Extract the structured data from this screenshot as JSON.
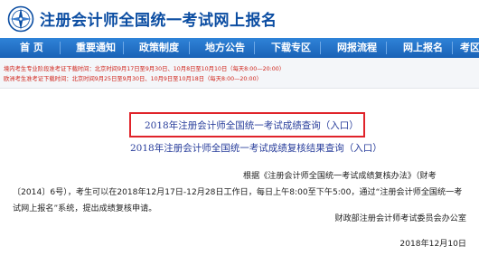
{
  "header": {
    "site_title": "注册会计师全国统一考试网上报名"
  },
  "nav": {
    "items": [
      {
        "label": "首 页"
      },
      {
        "label": "重要通知"
      },
      {
        "label": "政策制度"
      },
      {
        "label": "地方公告"
      },
      {
        "label": "下载专区"
      },
      {
        "label": "网报流程"
      },
      {
        "label": "网上报名"
      },
      {
        "label": "考区"
      }
    ]
  },
  "notices": {
    "line1": "境内考生专业阶段准考证下载时间：北京时间9月17日至9月30日、10月8日至10月10日（每天8:00—20:00）",
    "line2": "欧洲考生准考证下载时间：北京时间9月25日至9月30日、10月9日至10月18日（每天8:00—20:00）"
  },
  "links": {
    "score_query": "2018年注册会计师全国统一考试成绩查询（入口）",
    "review_query": "2018年注册会计师全国统一考试成绩复核结果查询（入口）"
  },
  "content": {
    "paragraph": "根据《注册会计师全国统一考试成绩复核办法》（财考〔2014〕6号），考生可以在2018年12月17日-12月28日工作日，每日上午8:00至下午5:00，通过“注册会计师全国统一考试网上报名”系统，提出成绩复核申请。",
    "signer": "财政部注册会计师考试委员会办公室",
    "date": "2018年12月10日"
  },
  "colors": {
    "title_blue": "#0b4da2",
    "nav_blue": "#1a62b6",
    "notice_red": "#d0241b",
    "highlight_red": "#e0232a",
    "link_blue": "#2a3f9c"
  }
}
